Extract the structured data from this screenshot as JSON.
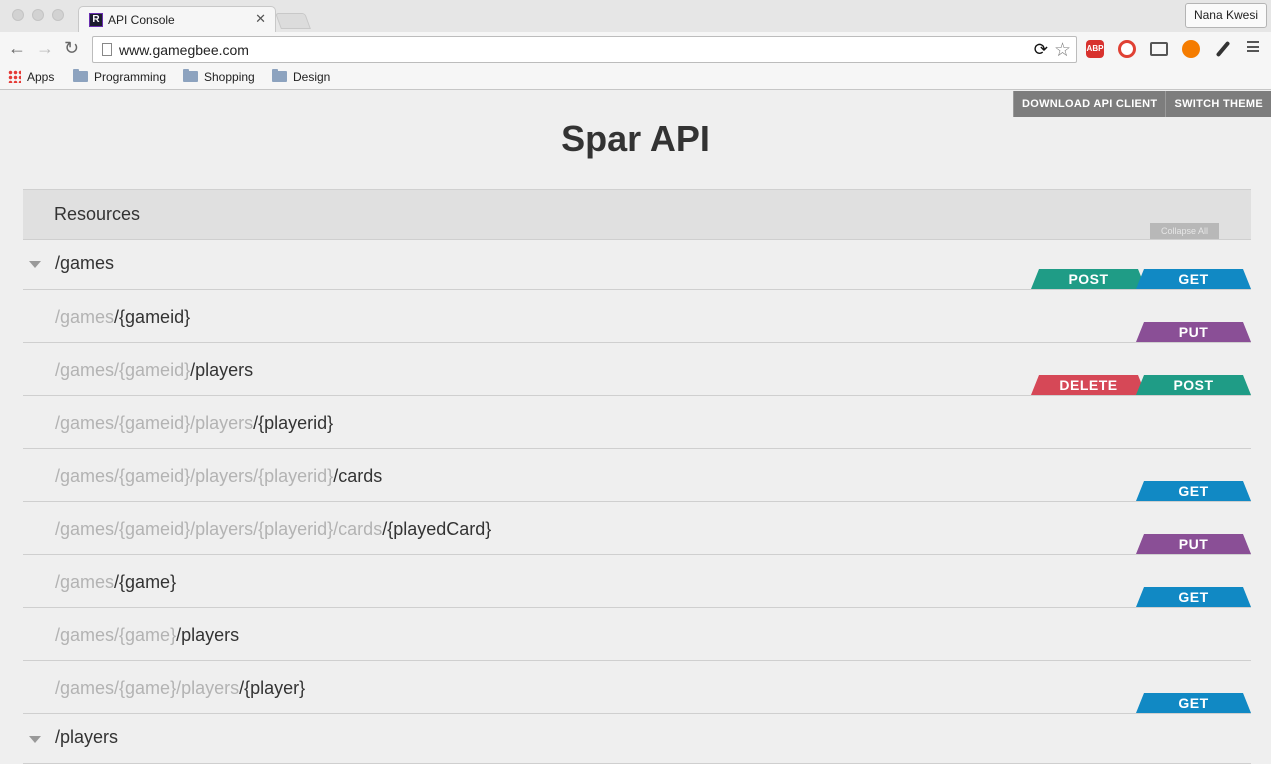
{
  "browser": {
    "tab_title": "API Console",
    "tab_favicon_letter": "R",
    "profile_name": "Nana Kwesi",
    "url": "www.gamegbee.com",
    "extensions": [
      {
        "name": "adblock-plus-icon",
        "label": "ABP",
        "color": "#d8322e"
      },
      {
        "name": "hand-block-icon",
        "label": "",
        "color": "#e04134"
      },
      {
        "name": "cast-icon",
        "label": "",
        "color": "#555555"
      },
      {
        "name": "fire-icon",
        "label": "",
        "color": "#f57c00"
      },
      {
        "name": "eyedropper-icon",
        "label": "",
        "color": "#333333"
      }
    ],
    "bookmarks": [
      "Apps",
      "Programming",
      "Shopping",
      "Design"
    ]
  },
  "page": {
    "download_label": "DOWNLOAD API CLIENT",
    "theme_label": "SWITCH THEME",
    "title": "Spar API",
    "resources_label": "Resources",
    "collapse_all_label": "Collapse All"
  },
  "groups": [
    {
      "path": "/games"
    },
    {
      "path": "/players"
    }
  ],
  "resources": [
    {
      "prefix": "/games",
      "suffix": "/{gameid}",
      "methods": [
        "PUT"
      ]
    },
    {
      "prefix": "/games/{gameid}",
      "suffix": "/players",
      "methods": [
        "DELETE",
        "POST"
      ]
    },
    {
      "prefix": "/games/{gameid}/players",
      "suffix": "/{playerid}",
      "methods": []
    },
    {
      "prefix": "/games/{gameid}/players/{playerid}",
      "suffix": "/cards",
      "methods": [
        "GET"
      ]
    },
    {
      "prefix": "/games/{gameid}/players/{playerid}/cards",
      "suffix": "/{playedCard}",
      "methods": [
        "PUT"
      ]
    },
    {
      "prefix": "/games",
      "suffix": "/{game}",
      "methods": [
        "GET"
      ]
    },
    {
      "prefix": "/games/{game}",
      "suffix": "/players",
      "methods": []
    },
    {
      "prefix": "/games/{game}/players",
      "suffix": "/{player}",
      "methods": [
        "GET"
      ]
    }
  ],
  "games_group_methods": [
    "POST",
    "GET"
  ],
  "colors": {
    "GET": "#1189c4",
    "POST": "#1f9c86",
    "PUT": "#8a4f96",
    "DELETE": "#d64857"
  }
}
